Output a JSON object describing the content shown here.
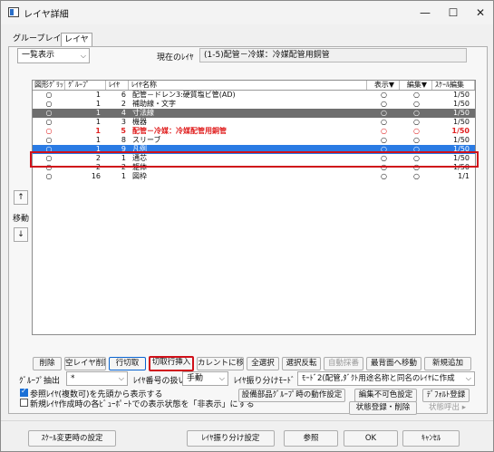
{
  "window": {
    "title": "レイヤ詳細",
    "minimize": "—",
    "maximize": "☐",
    "close": "✕"
  },
  "tabs": [
    "グループレイヤ",
    "レイヤ"
  ],
  "view_select": {
    "value": "一覧表示"
  },
  "current": {
    "label": "現在のﾚｲﾔ",
    "value": "(1-5)配管－冷媒：冷媒配管用銅管"
  },
  "grid": {
    "headers": [
      "図形ｸﾞﾘｯﾌﾟ",
      "ｸﾞﾙｰﾌﾟ",
      "ﾚｲﾔ",
      "ﾚｲﾔ名称",
      "表示▼",
      "編集▼",
      "ｽｹｰﾙ編集"
    ],
    "rows": [
      {
        "grip": "○",
        "group": "1",
        "layer": "6",
        "name": "配管－ドレン3:硬質塩ビ管(AD)",
        "show": "○",
        "edit": "○",
        "scale": "1/50",
        "style": "normal"
      },
      {
        "grip": "○",
        "group": "1",
        "layer": "2",
        "name": "補助線・文字",
        "show": "○",
        "edit": "○",
        "scale": "1/50",
        "style": "normal"
      },
      {
        "grip": "○",
        "group": "1",
        "layer": "4",
        "name": "寸法線",
        "show": "○",
        "edit": "○",
        "scale": "1/50",
        "style": "gray"
      },
      {
        "grip": "○",
        "group": "1",
        "layer": "3",
        "name": "機器",
        "show": "○",
        "edit": "○",
        "scale": "1/50",
        "style": "normal"
      },
      {
        "grip": "○",
        "group": "1",
        "layer": "5",
        "name": "配管－冷媒：冷媒配管用銅管",
        "show": "○",
        "edit": "○",
        "scale": "1/50",
        "style": "red"
      },
      {
        "grip": "○",
        "group": "1",
        "layer": "8",
        "name": "スリーブ",
        "show": "○",
        "edit": "○",
        "scale": "1/50",
        "style": "normal"
      },
      {
        "grip": "○",
        "group": "1",
        "layer": "9",
        "name": "凡例",
        "show": "○",
        "edit": "○",
        "scale": "1/50",
        "style": "selected"
      },
      {
        "grip": "○",
        "group": "2",
        "layer": "1",
        "name": "通芯",
        "show": "○",
        "edit": "○",
        "scale": "1/50",
        "style": "normal"
      },
      {
        "grip": "○",
        "group": "2",
        "layer": "2",
        "name": "躯体",
        "show": "○",
        "edit": "○",
        "scale": "1/50",
        "style": "normal"
      },
      {
        "grip": "○",
        "group": "16",
        "layer": "1",
        "name": "図枠",
        "show": "○",
        "edit": "○",
        "scale": "1/1",
        "style": "normal"
      }
    ]
  },
  "move": {
    "up": "↑",
    "label": "移動",
    "down": "↓"
  },
  "row_buttons": [
    "削除",
    "空レイヤ削除",
    "行切取",
    "切取行挿入",
    "カレントに移動",
    "全選択",
    "選択反転",
    "自動採番",
    "最背面へ移動",
    "新規追加"
  ],
  "group_extract": {
    "label": "ｸﾞﾙｰﾌﾟ抽出",
    "value": "*"
  },
  "layer_number": {
    "label": "ﾚｲﾔ番号の扱い",
    "value": "手動"
  },
  "assign_mode": {
    "label": "ﾚｲﾔ振り分けﾓｰﾄﾞ",
    "value": "ﾓｰﾄﾞ2(配管,ﾀﾞｸﾄ用途名称と同名のﾚｲﾔに作成"
  },
  "checks": [
    {
      "label": "参照ﾚｲﾔ(複数可)を先頭から表示する",
      "checked": true
    },
    {
      "label": "新規ﾚｲﾔ作成時の各ﾋﾞｭｰﾎﾟｰﾄでの表示状態を「非表示」にする",
      "checked": false
    }
  ],
  "right_buttons": {
    "equipment_group": "設備部品ｸﾞﾙｰﾌﾟ時の動作設定",
    "uneditable_color": "編集不可色設定",
    "default_register": "ﾃﾞﾌｫﾙﾄ登録",
    "state_register": "状態登録・削除",
    "state_load": "状態呼出 ▸"
  },
  "footer": {
    "scale_change": "ｽｹｰﾙ変更時の設定",
    "assign_settings": "ﾚｲﾔ振り分け設定",
    "reference": "参照",
    "ok": "OK",
    "cancel": "ｷｬﾝｾﾙ"
  }
}
